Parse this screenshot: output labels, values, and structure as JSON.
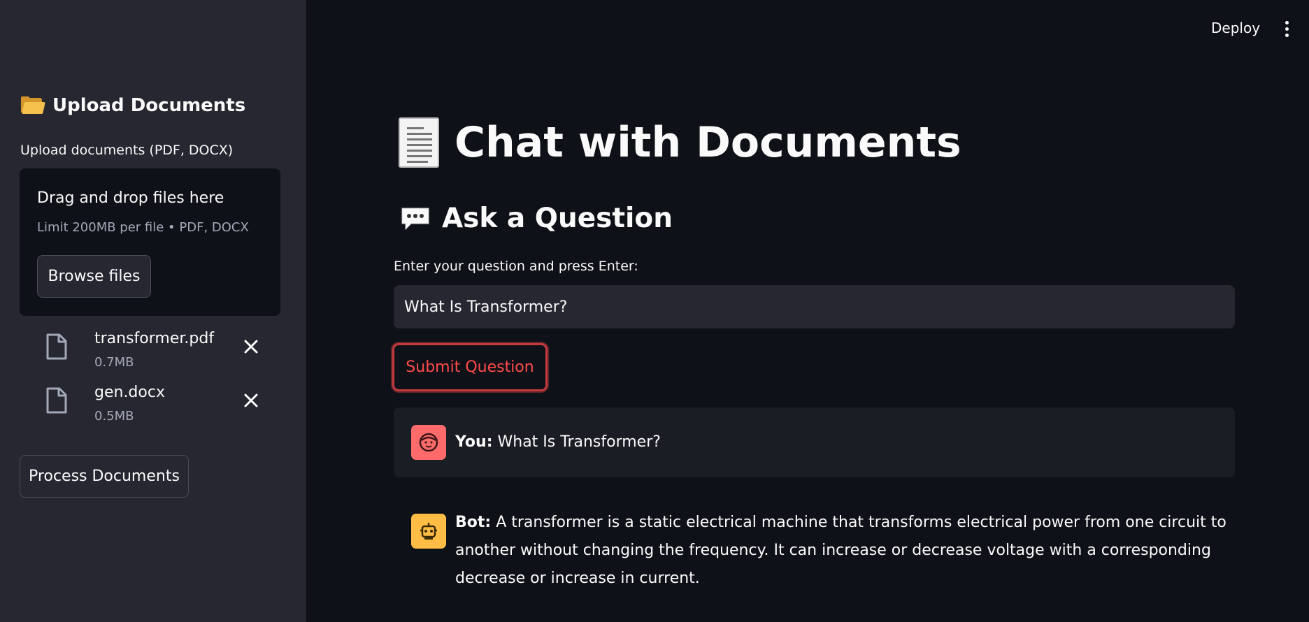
{
  "header": {
    "deploy_label": "Deploy",
    "menu_icon": "kebab-menu-icon"
  },
  "sidebar": {
    "title": "Upload Documents",
    "title_icon": "folder-icon",
    "uploader_label": "Upload documents (PDF, DOCX)",
    "dropzone": {
      "title": "Drag and drop files here",
      "limit": "Limit 200MB per file • PDF, DOCX",
      "browse_label": "Browse files"
    },
    "files": [
      {
        "name": "transformer.pdf",
        "size": "0.7MB"
      },
      {
        "name": "gen.docx",
        "size": "0.5MB"
      }
    ],
    "process_label": "Process Documents"
  },
  "main": {
    "title": "Chat with Documents",
    "title_icon": "document-icon",
    "subtitle": "Ask a Question",
    "subtitle_icon": "speech-bubble-icon",
    "question_label": "Enter your question and press Enter:",
    "question_value": "What Is Transformer?",
    "submit_label": "Submit Question",
    "messages": [
      {
        "author": "You:",
        "text": " What Is Transformer?"
      },
      {
        "author": "Bot:",
        "text": " A transformer is a static electrical machine that transforms electrical power from one circuit to another without changing the frequency. It can increase or decrease voltage with a corresponding decrease or increase in current."
      }
    ]
  },
  "colors": {
    "app_bg": "#0e1117",
    "sidebar_bg": "#262730",
    "accent": "#ff4b4b",
    "user_avatar": "#ff6b6b",
    "bot_avatar": "#ffbd45"
  }
}
